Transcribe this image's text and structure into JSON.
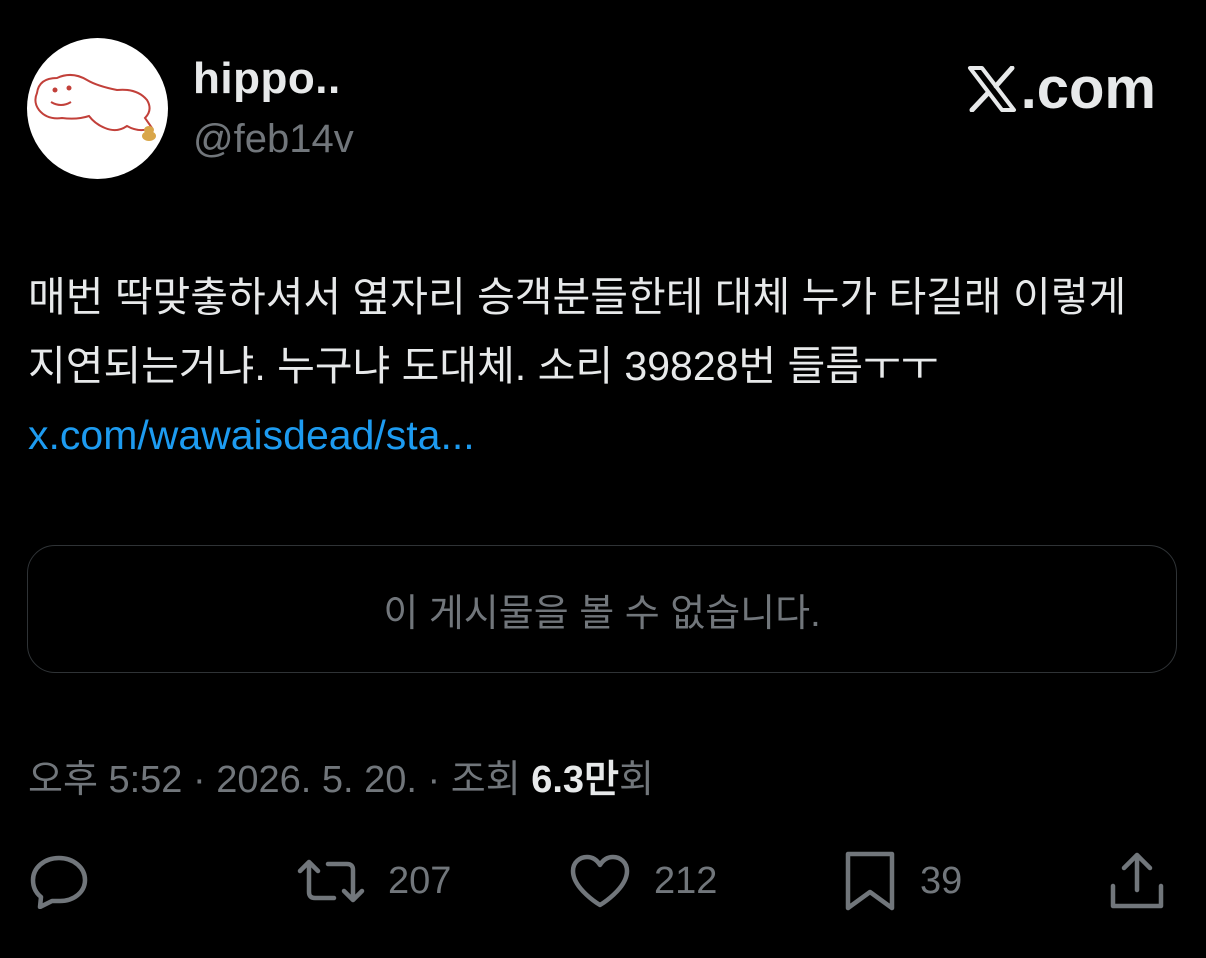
{
  "author": {
    "display_name": "hippo..",
    "handle": "@feb14v"
  },
  "brand": {
    "label": ".com"
  },
  "tweet": {
    "text": "매번 딱맞춯하셔서 옆자리 승객분들한테 대체 누가 타길래 이렇게 지연되는거냐. 누구냐 도대체. 소리 39828번 들름ㅜㅜ ",
    "link_text": "x.com/wawaisdead/sta..."
  },
  "quoted_card": {
    "message": "이 게시물을 볼 수 없습니다."
  },
  "meta": {
    "time": "오후 5:52",
    "separator": " · ",
    "date": "2026. 5. 20.",
    "views_label": "조회 ",
    "views_number": "6.3만",
    "views_suffix": "회"
  },
  "actions": {
    "reply_count": "",
    "retweet_count": "207",
    "like_count": "212",
    "bookmark_count": "39"
  },
  "colors": {
    "background": "#000000",
    "text": "#e7e9ea",
    "muted": "#71767b",
    "link": "#1d9bf0",
    "border": "#2f3336"
  },
  "icons": {
    "reply": "reply-icon",
    "retweet": "retweet-icon",
    "like": "heart-icon",
    "bookmark": "bookmark-icon",
    "share": "share-icon",
    "brand": "x-logo-icon"
  }
}
